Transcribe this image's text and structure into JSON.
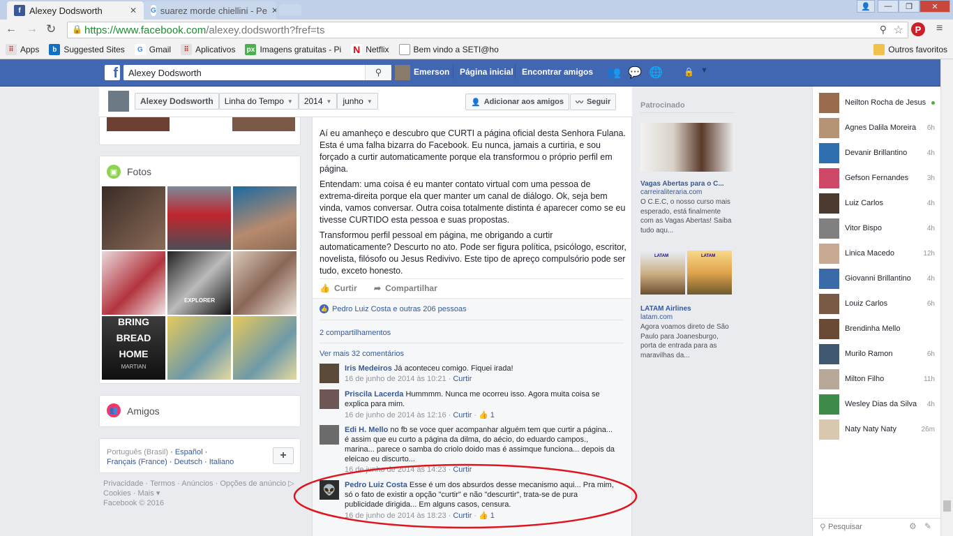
{
  "browser": {
    "tabs": [
      {
        "title": "Alexey Dodsworth"
      },
      {
        "title": "suarez morde chiellini - Pe"
      }
    ],
    "url_prefix": "https://www.facebook.com",
    "url_path": "/alexey.dodsworth?fref=ts",
    "bookmarks": [
      "Apps",
      "Suggested Sites",
      "Gmail",
      "Aplicativos",
      "Imagens gratuitas - Pi",
      "Netflix",
      "Bem vindo a SETI@ho"
    ],
    "other_bookmarks": "Outros favoritos"
  },
  "fb": {
    "search_value": "Alexey Dodsworth",
    "user_name": "Emerson",
    "nav_home": "Página inicial",
    "nav_find_friends": "Encontrar amigos"
  },
  "profile": {
    "name_btn": "Alexey Dodsworth",
    "timeline_btn": "Linha do Tempo",
    "year_btn": "2014",
    "month_btn": "junho",
    "add_friend": "Adicionar aos amigos",
    "follow": "Seguir"
  },
  "left": {
    "photos_title": "Fotos",
    "friends_title": "Amigos",
    "languages": {
      "current": "Português (Brasil)",
      "l1": "Español",
      "l2": "Français (France)",
      "l3": "Deutsch",
      "l4": "Italiano"
    },
    "footer": {
      "f1": "Privacidade",
      "f2": "Termos",
      "f3": "Anúncios",
      "f4": "Opções de anúncio",
      "f5": "Cookies",
      "f6": "Mais",
      "copyright": "Facebook © 2016"
    },
    "photo_texts": {
      "bring": "BRING",
      "bread": "BREAD",
      "home": "HOME",
      "martian": "MARTIAN",
      "explorer": "EXPLORER"
    }
  },
  "post": {
    "p1": "Aí eu amanheço e descubro que CURTI a página oficial desta Senhora Fulana. Esta é uma falha bizarra do Facebook. Eu nunca, jamais a curtiria, e sou forçado a curtir automaticamente porque ela transformou o próprio perfil em página.",
    "p2": "Entendam: uma coisa é eu manter contato virtual com uma pessoa de extrema-direita porque ela quer manter um canal de diálogo. Ok, seja bem vinda, vamos conversar. Outra coisa totalmente distinta é aparecer como se eu tivesse CURTIDO esta pessoa e suas propostas.",
    "p3": "Transformou perfil pessoal em página, me obrigando a curtir automaticamente? Descurto no ato. Pode ser figura política, psicólogo, escritor, novelista, filósofo ou Jesus Redivivo. Este tipo de apreço compulsório pode ser tudo, exceto honesto.",
    "like": "Curtir",
    "share": "Compartilhar",
    "likes_summary": "Pedro Luiz Costa e outras 206 pessoas",
    "shares": "2 compartilhamentos",
    "more_comments": "Ver mais 32 comentários",
    "comments": [
      {
        "name": "Iris Medeiros",
        "text": "Já aconteceu comigo. Fiquei irada!",
        "date": "16 de junho de 2014 às 10:21",
        "action": "Curtir",
        "likes": ""
      },
      {
        "name": "Priscila Lacerda",
        "text": "Hummmm. Nunca me ocorreu isso. Agora muita coisa se explica para mim.",
        "date": "16 de junho de 2014 às 12:16",
        "action": "Curtir",
        "likes": "1"
      },
      {
        "name": "Edi H. Mello",
        "text": "no fb se voce quer acompanhar alguém tem que curtir a página... é assim que eu curto a página da dilma, do aécio, do eduardo campos., marina... parece o samba do criolo doido mas é assimque funciona... depois da eleicao eu discurto...",
        "date": "16 de junho de 2014 às 14:23",
        "action": "Curtir",
        "likes": ""
      },
      {
        "name": "Pedro Luiz Costa",
        "text": "Esse é um dos absurdos desse mecanismo aqui... Pra mim, só o fato de existir a opção \"curtir\" e não \"descurtir\", trata-se de pura publicidade dirigida... Em alguns casos, censura.",
        "date": "16 de junho de 2014 às 18:23",
        "action": "Curtir",
        "likes": "1"
      }
    ]
  },
  "sponsored": {
    "title": "Patrocinado",
    "ad1": {
      "title": "Vagas Abertas para o C...",
      "domain": "carreiraliteraria.com",
      "text": "O C.E.C, o nosso curso mais esperado, está finalmente com as Vagas Abertas! Saiba tudo aqu..."
    },
    "ad2": {
      "title": "LATAM Airlines",
      "domain": "latam.com",
      "text": "Agora voamos direto de São Paulo para Joanesburgo, porta de entrada para as maravilhas da...",
      "brand": "LATAM"
    }
  },
  "chat": {
    "contacts": [
      {
        "name": "Neilton Rocha de Jesus",
        "time": ""
      },
      {
        "name": "Agnes Dalila Moreira",
        "time": "6h"
      },
      {
        "name": "Devanir Brillantino",
        "time": "4h"
      },
      {
        "name": "Gefson Fernandes",
        "time": "3h"
      },
      {
        "name": "Luiz Carlos",
        "time": "4h"
      },
      {
        "name": "Vitor Bispo",
        "time": "4h"
      },
      {
        "name": "Linica Macedo",
        "time": "12h"
      },
      {
        "name": "Giovanni Brillantino",
        "time": "4h"
      },
      {
        "name": "Louiz Carlos",
        "time": "6h"
      },
      {
        "name": "Brendinha Mello",
        "time": ""
      },
      {
        "name": "Murilo Ramon",
        "time": "6h"
      },
      {
        "name": "Milton Filho",
        "time": "11h"
      },
      {
        "name": "Wesley Dias da Silva",
        "time": "4h"
      },
      {
        "name": "Naty Naty Naty",
        "time": "26m"
      }
    ],
    "search_placeholder": "Pesquisar"
  },
  "colors": {
    "fb_blue": "#4267b2",
    "link": "#365899",
    "annotation_red": "#e0141e",
    "online": "#42b72a"
  }
}
